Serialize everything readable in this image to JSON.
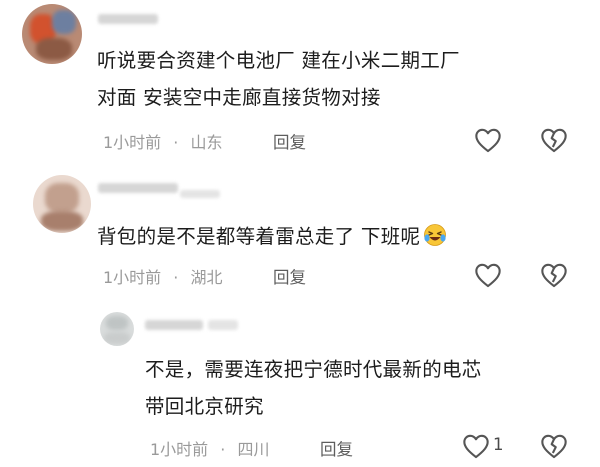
{
  "comments": [
    {
      "text_line1": "听说要合资建个电池厂  建在小米二期工厂",
      "text_line2": "对面 安装空中走廊直接货物对接",
      "time": "1小时前",
      "separator": "·",
      "location": "山东",
      "reply_label": "回复",
      "like_count": ""
    },
    {
      "text_line1": "背包的是不是都等着雷总走了 下班呢",
      "time": "1小时前",
      "separator": "·",
      "location": "湖北",
      "reply_label": "回复",
      "like_count": ""
    },
    {
      "text_line1": "不是，需要连夜把宁德时代最新的电芯",
      "text_line2": "带回北京研究",
      "time": "1小时前",
      "separator": "·",
      "location": "四川",
      "reply_label": "回复",
      "like_count": "1"
    }
  ],
  "colors": {
    "text": "#1c1c1c",
    "meta": "#9a9a9a",
    "icon": "#555555"
  },
  "icons": [
    "heart-outline-icon",
    "broken-heart-icon",
    "laughing-tears-emoji"
  ]
}
